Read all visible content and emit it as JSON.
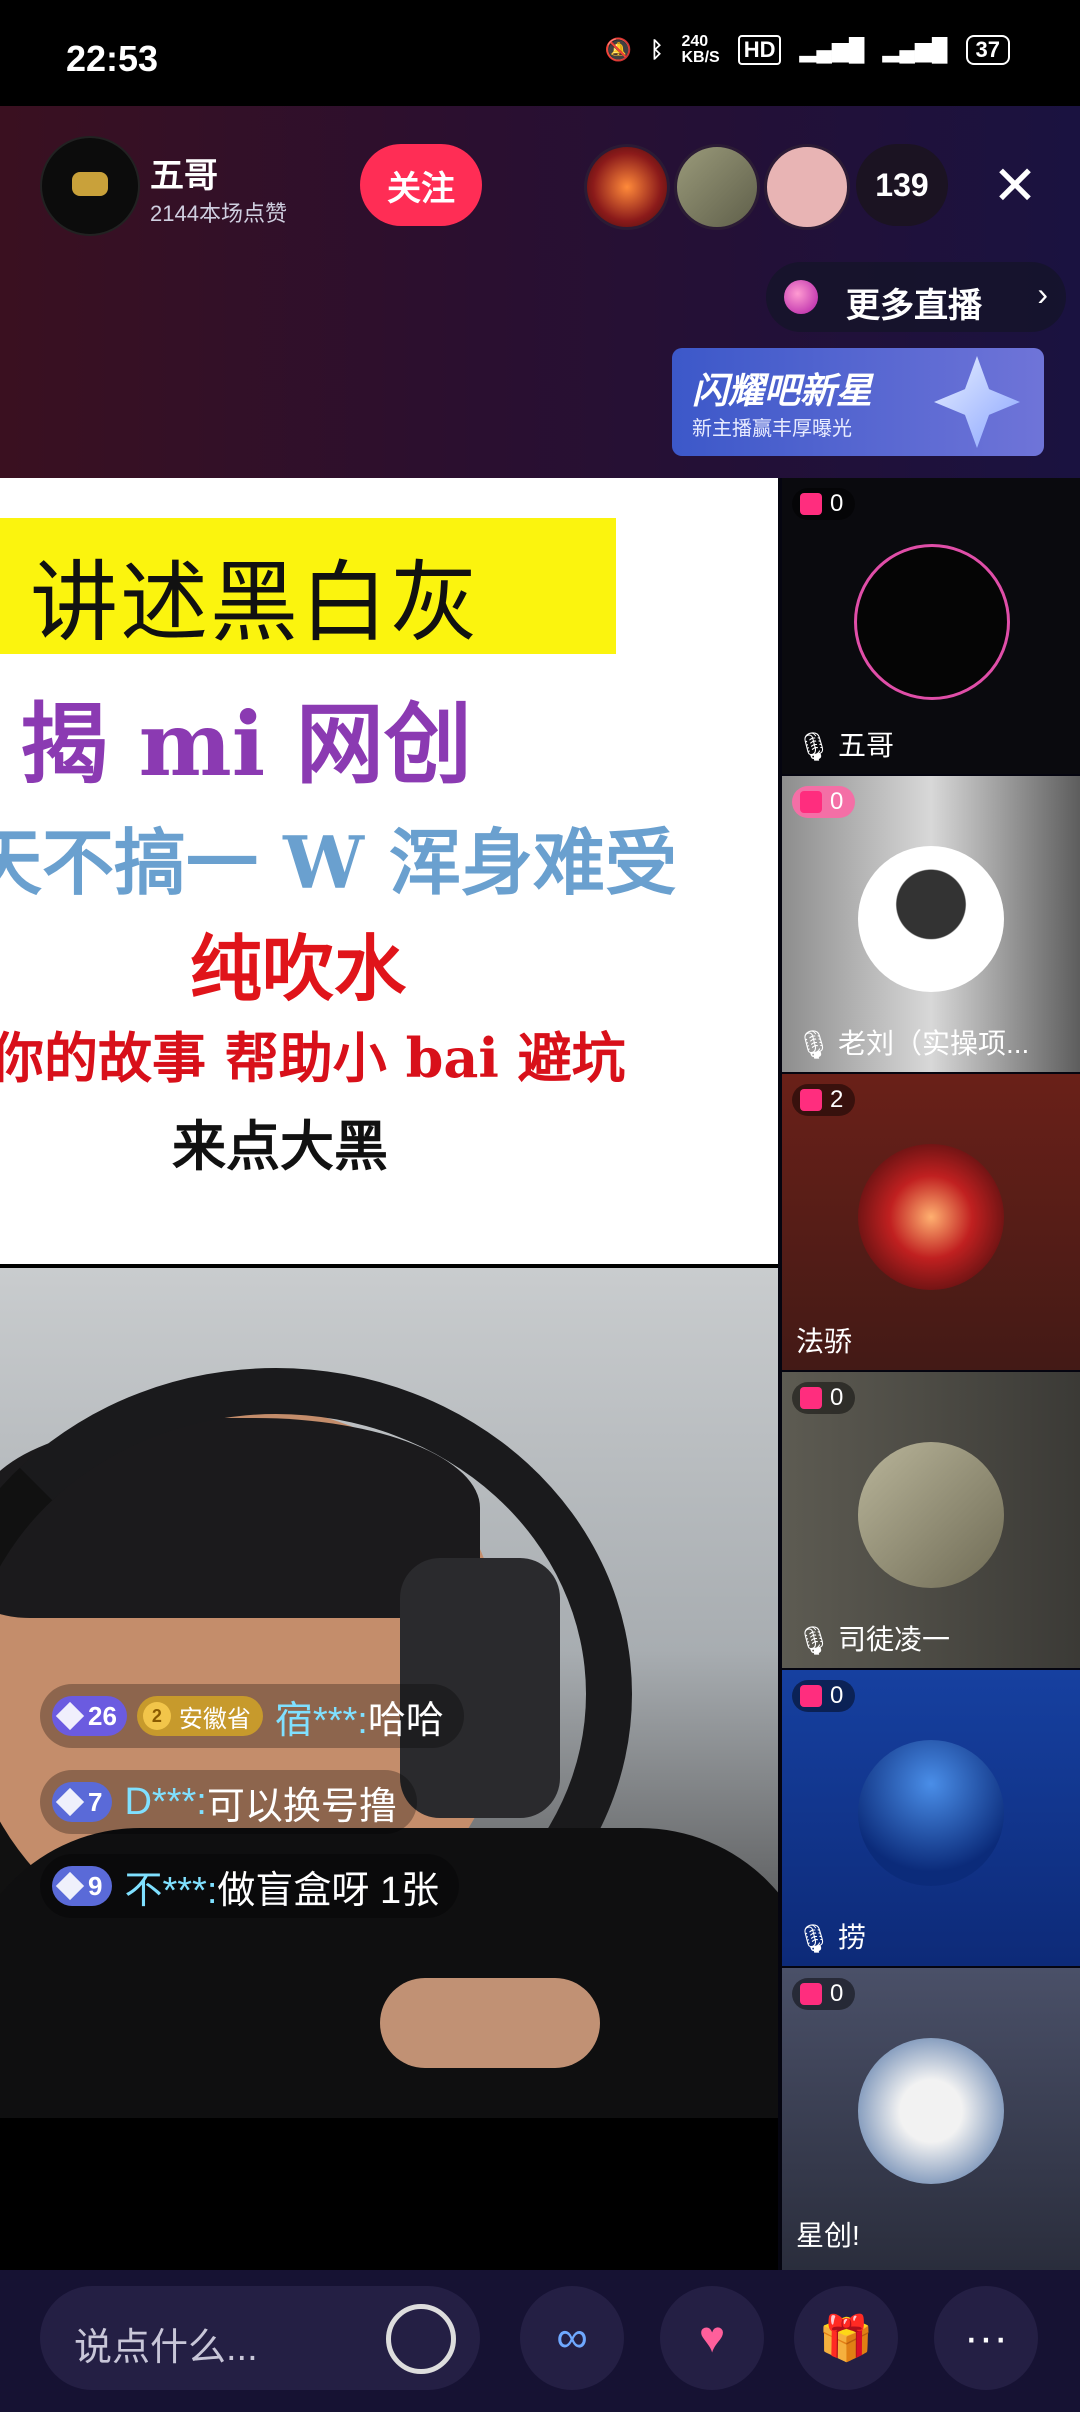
{
  "status_bar": {
    "time": "22:53",
    "net_speed": "240\nKB/S",
    "battery": "37"
  },
  "host": {
    "name": "五哥",
    "likes": "2144本场点赞",
    "follow_label": "关注"
  },
  "viewers": {
    "count": "139"
  },
  "more_live": {
    "label": "更多直播"
  },
  "promo_banner": {
    "title": "闪耀吧新星",
    "subtitle": "新主播赢丰厚曝光"
  },
  "poster": {
    "line1": "讲述黑白灰",
    "line2": "揭 mi 网创",
    "line3": "天不搞一 W 浑身难受",
    "line4": "纯吹水",
    "line5": "你的故事  帮助小 bai 避坑",
    "line6": "来点大黑"
  },
  "comments": [
    {
      "level": "26",
      "province": "安徽省",
      "province_rank": "2",
      "user": "宿***:",
      "message": "哈哈"
    },
    {
      "level": "7",
      "user": "D***:",
      "message": "可以换号撸"
    },
    {
      "level": "9",
      "user": "不***:",
      "message": "做盲盒呀  1张"
    }
  ],
  "seats": [
    {
      "gifts": "0",
      "name": "五哥",
      "muted": true
    },
    {
      "gifts": "0",
      "name": "老刘（实操项...",
      "muted": true
    },
    {
      "gifts": "2",
      "name": "法骄",
      "muted": false
    },
    {
      "gifts": "0",
      "name": "司徒凌一",
      "muted": true
    },
    {
      "gifts": "0",
      "name": "捞",
      "muted": true
    },
    {
      "gifts": "0",
      "name": "星创!",
      "muted": false
    }
  ],
  "bottom": {
    "input_placeholder": "说点什么..."
  },
  "colors": {
    "follow": "#ff2d55",
    "comment_user": "#7fe0ff",
    "poster_highlight": "#fbf40e"
  }
}
